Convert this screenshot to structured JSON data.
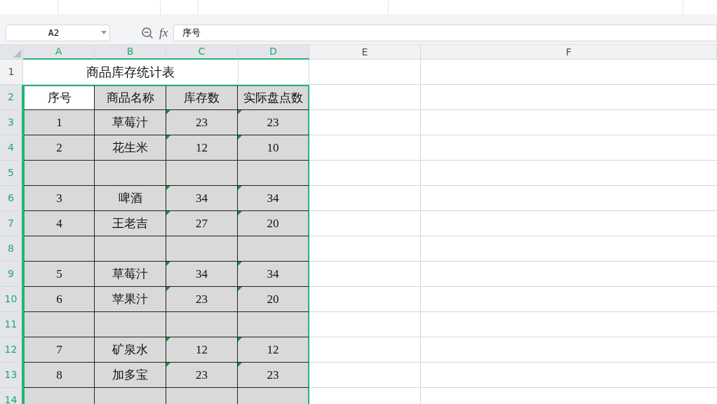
{
  "name_box": {
    "value": "A2"
  },
  "formula_bar": {
    "label": "fx",
    "value": "序号"
  },
  "columns": [
    {
      "label": "A",
      "selected": true
    },
    {
      "label": "B",
      "selected": true
    },
    {
      "label": "C",
      "selected": true
    },
    {
      "label": "D",
      "selected": true
    },
    {
      "label": "E",
      "selected": false
    },
    {
      "label": "F",
      "selected": false
    }
  ],
  "title_row": {
    "number": "1",
    "selected": false,
    "title": "商品库存统计表"
  },
  "rows": [
    {
      "number": "2",
      "selected": true,
      "cells": [
        {
          "text": "序号",
          "active": true
        },
        {
          "text": "商品名称",
          "active": false
        },
        {
          "text": "库存数",
          "active": false
        },
        {
          "text": "实际盘点数",
          "active": false
        }
      ]
    },
    {
      "number": "3",
      "selected": true,
      "cells": [
        {
          "text": "1",
          "active": false
        },
        {
          "text": "草莓汁",
          "active": false
        },
        {
          "text": "23",
          "active": false,
          "warn": true
        },
        {
          "text": "23",
          "active": false,
          "warn": true
        }
      ]
    },
    {
      "number": "4",
      "selected": true,
      "cells": [
        {
          "text": "2",
          "active": false
        },
        {
          "text": "花生米",
          "active": false
        },
        {
          "text": "12",
          "active": false,
          "warn": true
        },
        {
          "text": "10",
          "active": false,
          "warn": true
        }
      ]
    },
    {
      "number": "5",
      "selected": true,
      "cells": [
        {
          "active": false
        },
        {
          "active": false
        },
        {
          "active": false
        },
        {
          "active": false
        }
      ]
    },
    {
      "number": "6",
      "selected": true,
      "cells": [
        {
          "text": "3",
          "active": false
        },
        {
          "text": "啤酒",
          "active": false
        },
        {
          "text": "34",
          "active": false,
          "warn": true
        },
        {
          "text": "34",
          "active": false,
          "warn": true
        }
      ]
    },
    {
      "number": "7",
      "selected": true,
      "cells": [
        {
          "text": "4",
          "active": false
        },
        {
          "text": "王老吉",
          "active": false
        },
        {
          "text": "27",
          "active": false,
          "warn": true
        },
        {
          "text": "20",
          "active": false,
          "warn": true
        }
      ]
    },
    {
      "number": "8",
      "selected": true,
      "cells": [
        {
          "active": false
        },
        {
          "active": false
        },
        {
          "active": false
        },
        {
          "active": false
        }
      ]
    },
    {
      "number": "9",
      "selected": true,
      "cells": [
        {
          "text": "5",
          "active": false
        },
        {
          "text": "草莓汁",
          "active": false
        },
        {
          "text": "34",
          "active": false,
          "warn": true
        },
        {
          "text": "34",
          "active": false,
          "warn": true
        }
      ]
    },
    {
      "number": "10",
      "selected": true,
      "cells": [
        {
          "text": "6",
          "active": false
        },
        {
          "text": "苹果汁",
          "active": false
        },
        {
          "text": "23",
          "active": false,
          "warn": true
        },
        {
          "text": "20",
          "active": false,
          "warn": true
        }
      ]
    },
    {
      "number": "11",
      "selected": true,
      "cells": [
        {
          "active": false
        },
        {
          "active": false
        },
        {
          "active": false
        },
        {
          "active": false
        }
      ]
    },
    {
      "number": "12",
      "selected": true,
      "cells": [
        {
          "text": "7",
          "active": false
        },
        {
          "text": "矿泉水",
          "active": false
        },
        {
          "text": "12",
          "active": false,
          "warn": true
        },
        {
          "text": "12",
          "active": false,
          "warn": true
        }
      ]
    },
    {
      "number": "13",
      "selected": true,
      "cells": [
        {
          "text": "8",
          "active": false
        },
        {
          "text": "加多宝",
          "active": false
        },
        {
          "text": "23",
          "active": false,
          "warn": true
        },
        {
          "text": "23",
          "active": false,
          "warn": true
        }
      ]
    },
    {
      "number": "14",
      "selected": true,
      "cells": [
        {
          "active": false
        },
        {
          "active": false
        },
        {
          "active": false
        },
        {
          "active": false
        }
      ]
    }
  ]
}
